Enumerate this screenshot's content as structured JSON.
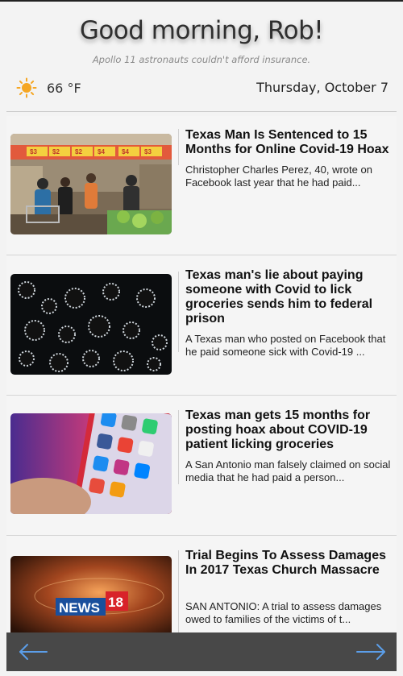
{
  "header": {
    "greeting": "Good morning, Rob!",
    "quote": "Apollo 11 astronauts couldn't afford insurance."
  },
  "weather": {
    "icon": "sun-icon",
    "temperature": "66 °F"
  },
  "date": "Thursday, October 7",
  "articles": [
    {
      "headline": "Texas Man Is Sentenced to 15 Months for Online Covid-19 Hoax",
      "summary": "Christopher Charles Perez, 40, wrote on Facebook last year that he had paid..."
    },
    {
      "headline": "Texas man's lie about paying someone with Covid to lick groceries sends him to federal prison",
      "summary": "A Texas man who posted on Facebook that he paid someone sick with Covid-19 ..."
    },
    {
      "headline": "Texas man gets 15 months for posting hoax about COVID-19 patient licking groceries",
      "summary": "A San Antonio man falsely claimed on social media that he had paid a person..."
    },
    {
      "headline": "Trial Begins To Assess Damages In 2017 Texas Church Massacre",
      "summary": "SAN ANTONIO: A trial to assess damages owed to families of the victims of t..."
    }
  ],
  "images": {
    "price_tags": [
      "$3",
      "$2",
      "$4",
      "$4",
      "$3",
      "$2"
    ],
    "news_logo": "NEWS",
    "news_logo_number": "18"
  },
  "navigation": {
    "prev_icon": "arrow-left-icon",
    "next_icon": "arrow-right-icon"
  },
  "colors": {
    "background": "#f3f3f3",
    "bottom_bar": "#484848",
    "arrow": "#5b9ee9",
    "sun": "#f5a623"
  }
}
